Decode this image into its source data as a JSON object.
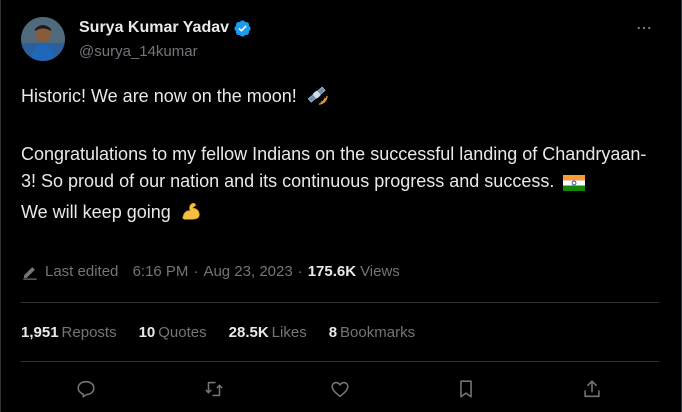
{
  "author": {
    "display_name": "Surya Kumar Yadav",
    "handle": "@surya_14kumar",
    "verified": true
  },
  "tweet": {
    "line1": "Historic! We are now on the moon!",
    "line1_emoji": "satellite",
    "line2": "Congratulations to my fellow Indians on the successful landing of Chandryaan-3! So proud of our nation and its continuous progress and success.",
    "line2_emoji": "india-flag",
    "line3": "We will keep going",
    "line3_emoji": "flexed-biceps"
  },
  "meta": {
    "edited_label": "Last edited",
    "time": "6:16 PM",
    "date": "Aug 23, 2023",
    "views_count": "175.6K",
    "views_label": "Views"
  },
  "stats": {
    "reposts_count": "1,951",
    "reposts_label": "Reposts",
    "quotes_count": "10",
    "quotes_label": "Quotes",
    "likes_count": "28.5K",
    "likes_label": "Likes",
    "bookmarks_count": "8",
    "bookmarks_label": "Bookmarks"
  },
  "icons": {
    "more": "more-horizontal-icon",
    "reply": "reply-icon",
    "retweet": "retweet-icon",
    "like": "heart-icon",
    "bookmark": "bookmark-icon",
    "share": "share-icon"
  },
  "colors": {
    "background": "#000000",
    "text": "#e7e9ea",
    "secondary": "#71767b",
    "verified": "#1d9bf0",
    "divider": "#2f3336"
  }
}
